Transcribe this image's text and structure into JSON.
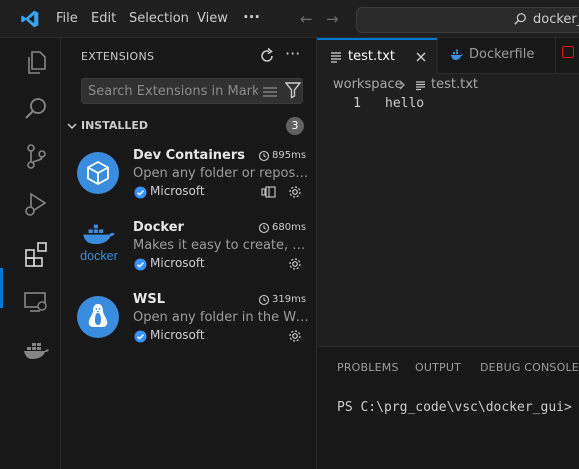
{
  "titlebar": {
    "menus": [
      "File",
      "Edit",
      "Selection",
      "View",
      "···"
    ],
    "command_center": "docker_gui"
  },
  "sidebar": {
    "title": "EXTENSIONS",
    "search_placeholder": "Search Extensions in Mark...",
    "installed_label": "INSTALLED",
    "installed_count": "3",
    "extensions": [
      {
        "name": "Dev Containers",
        "time": "895ms",
        "description": "Open any folder or repository inside a Docker container",
        "publisher": "Microsoft",
        "icon": "cube-icon",
        "has_remote": true
      },
      {
        "name": "Docker",
        "time": "680ms",
        "description": "Makes it easy to create, manage and debug containerized applications",
        "publisher": "Microsoft",
        "icon": "docker-logo",
        "has_remote": false
      },
      {
        "name": "WSL",
        "time": "319ms",
        "description": "Open any folder in the Windows Subsystem for Linux",
        "publisher": "Microsoft",
        "icon": "penguin-icon",
        "has_remote": false
      }
    ]
  },
  "editor": {
    "tabs": [
      {
        "label": "test.txt",
        "active": true
      },
      {
        "label": "Dockerfile",
        "active": false
      }
    ],
    "breadcrumb": {
      "root": "workspace",
      "file": "test.txt"
    },
    "lines": [
      {
        "number": "1",
        "text": "hello"
      }
    ]
  },
  "panel": {
    "tabs": [
      "PROBLEMS",
      "OUTPUT",
      "DEBUG CONSOLE"
    ],
    "terminal_text": "PS C:\\prg_code\\vsc\\docker_gui>"
  },
  "colors": {
    "accent": "#0078d4",
    "ext_icon_bg": "#3a8dde",
    "verified": "#3794ff"
  }
}
